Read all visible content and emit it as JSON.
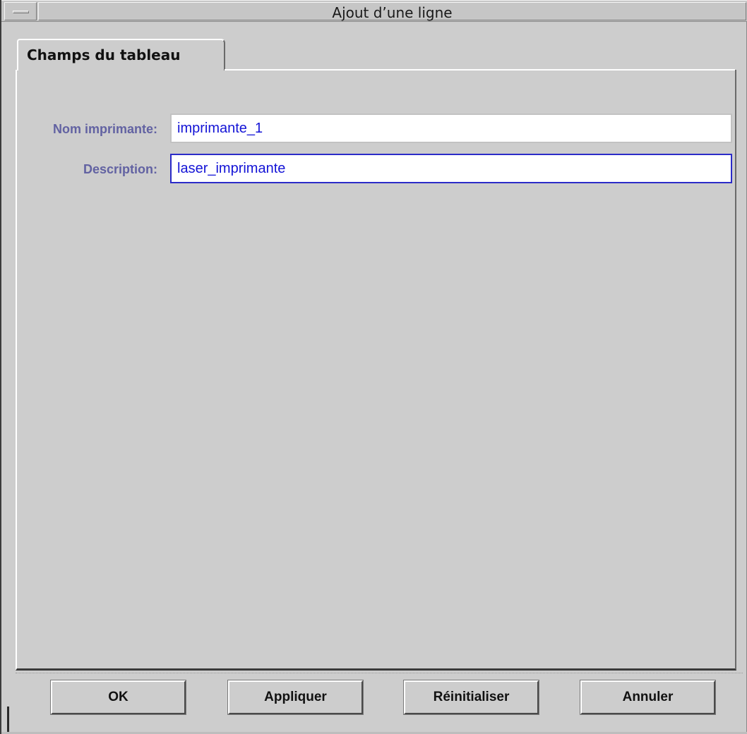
{
  "window": {
    "title": "Ajout d’une ligne"
  },
  "tabs": [
    {
      "label": "Champs du tableau",
      "active": true
    }
  ],
  "form": {
    "fields": [
      {
        "label": "Nom imprimante:",
        "value": "imprimante_1",
        "focused": false
      },
      {
        "label": "Description:",
        "value": "laser_imprimante",
        "focused": true
      }
    ]
  },
  "buttons": {
    "ok": "OK",
    "apply": "Appliquer",
    "reset": "Réinitialiser",
    "cancel": "Annuler"
  },
  "colors": {
    "background": "#cdcdcd",
    "label": "#6262a2",
    "input_text": "#1414d6",
    "focus_border": "#2b2bc8"
  }
}
